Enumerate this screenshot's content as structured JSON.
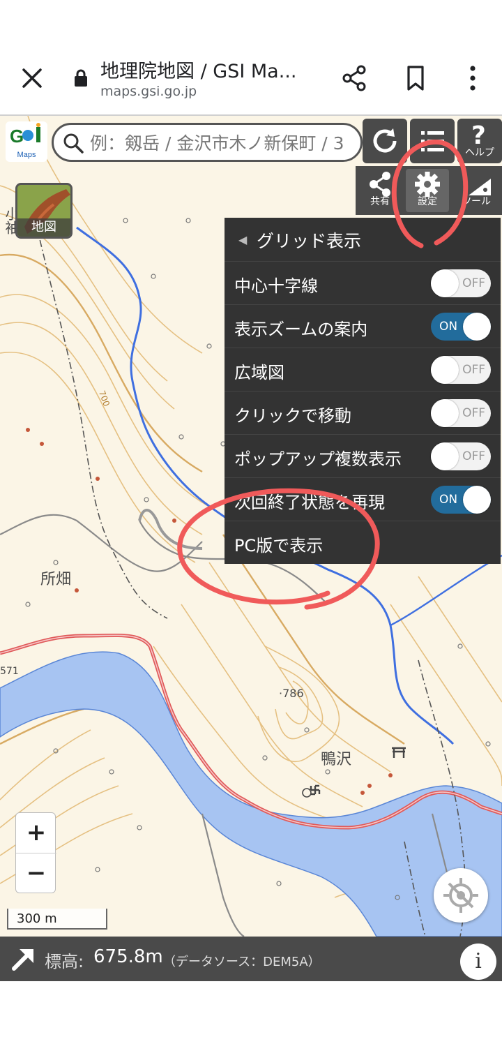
{
  "browser": {
    "page_title": "地理院地図 / GSI Ma...",
    "domain": "maps.gsi.go.jp"
  },
  "header": {
    "logo_text": "Maps",
    "search_placeholder": "例：剱岳 / 金沢市木ノ新保町 / 3",
    "help_label": "ヘルプ"
  },
  "tools": {
    "share_label": "共有",
    "settings_label": "設定",
    "tool_label": "ツール"
  },
  "map_type": {
    "label": "地図"
  },
  "menu": {
    "title": "グリッド表示",
    "rows": [
      {
        "label": "中心十字線",
        "state": "OFF"
      },
      {
        "label": "表示ズームの案内",
        "state": "ON"
      },
      {
        "label": "広域図",
        "state": "OFF"
      },
      {
        "label": "クリックで移動",
        "state": "OFF"
      },
      {
        "label": "ポップアップ複数表示",
        "state": "OFF"
      },
      {
        "label": "次回終了状態を再現",
        "state": "ON"
      },
      {
        "label": "PC版で表示"
      }
    ]
  },
  "map": {
    "place_names": [
      "所畑",
      "鴨沢",
      "小袖"
    ],
    "spot_height": "·786",
    "route_number": "571",
    "contour_label": "700"
  },
  "zoom": {
    "in": "+",
    "out": "−"
  },
  "scale": {
    "label": "300 m"
  },
  "elevation": {
    "label": "標高:",
    "value": "675.8m",
    "source": "（データソース：DEM5A）",
    "info": "i"
  },
  "colors": {
    "menu_bg": "#333333",
    "toggle_on": "#226c9c",
    "annotation": "#f05a5a",
    "river": "#3f6fe0",
    "lake": "#a7c4f2",
    "road": "#e05a5a",
    "contour": "#d9a85a"
  }
}
